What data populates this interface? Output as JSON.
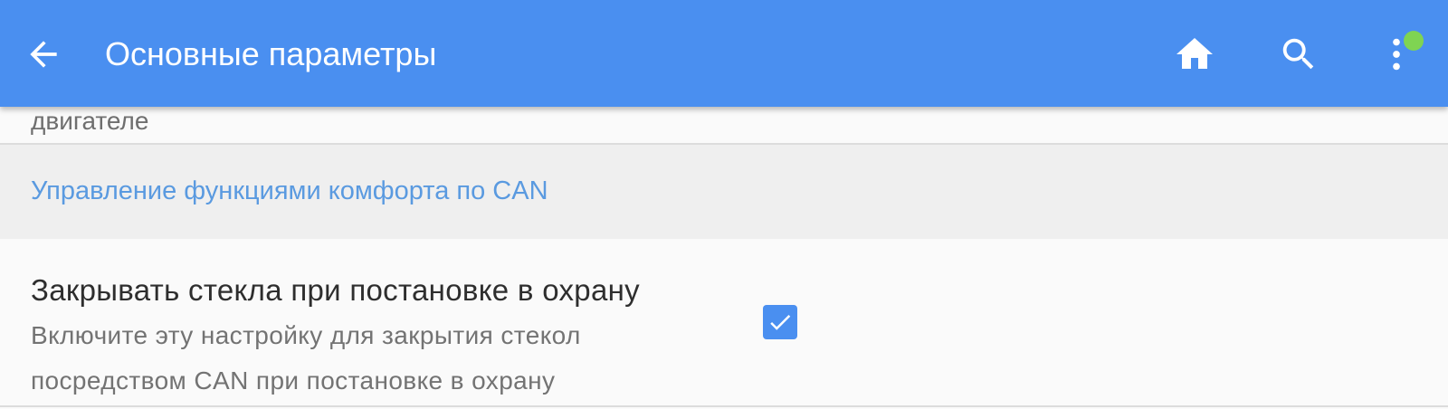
{
  "appbar": {
    "title": "Основные параметры",
    "back_icon": "arrow-back-icon",
    "home_icon": "home-icon",
    "search_icon": "search-icon",
    "more_icon": "more-vert-icon",
    "badge_color": "#7fd452",
    "background_color": "#4a8ff0"
  },
  "partial_row": {
    "text": "двигателе"
  },
  "category": {
    "title": "Управление функциями комфорта по CAN",
    "color": "#5a9ae0"
  },
  "preference": {
    "title": "Закрывать стекла при постановке в охрану",
    "summary_line1": "Включите эту настройку для закрытия стекол",
    "summary_line2": "посредством CAN при постановке в охрану",
    "checked": true
  }
}
